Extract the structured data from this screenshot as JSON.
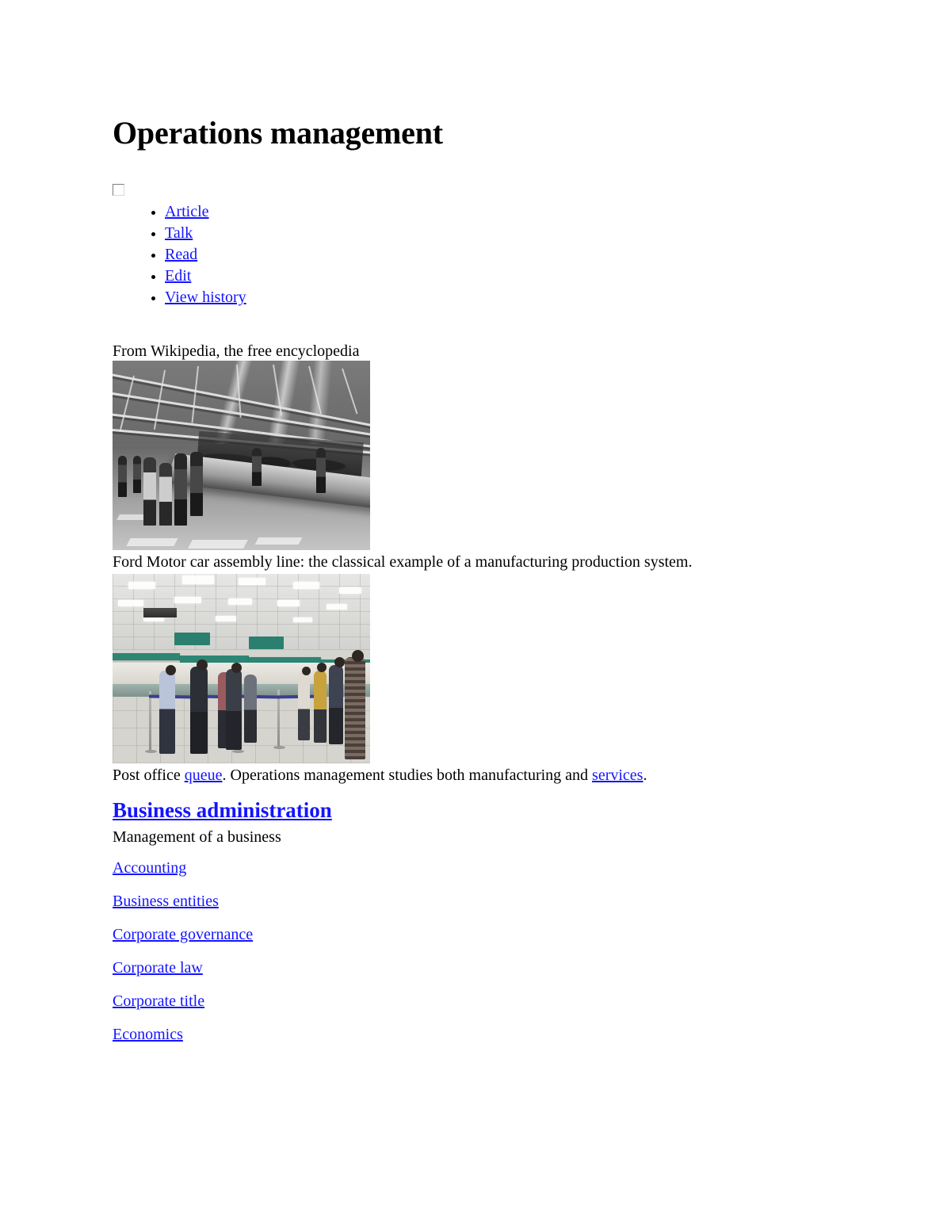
{
  "page": {
    "title": "Operations management",
    "source_line": "From Wikipedia, the free encyclopedia"
  },
  "namespace_tabs": [
    {
      "label": "Article"
    },
    {
      "label": "Talk"
    }
  ],
  "view_tabs": [
    {
      "label": "Read"
    },
    {
      "label": "Edit"
    },
    {
      "label": "View history"
    }
  ],
  "figures": [
    {
      "alt": "Ford Motor car assembly line",
      "caption": "Ford Motor car assembly line: the classical example of a manufacturing production system."
    },
    {
      "alt": "Post office queue",
      "caption_part_1": "Post office ",
      "caption_link_1": "queue",
      "caption_part_2": ". Operations management studies both manufacturing and ",
      "caption_link_2": "services",
      "caption_part_3": "."
    }
  ],
  "infobox": {
    "heading": "Business administration",
    "subtitle": "Management of a business",
    "links": [
      {
        "label": "Accounting"
      },
      {
        "label": "Business entities"
      },
      {
        "label": "Corporate governance"
      },
      {
        "label": "Corporate law"
      },
      {
        "label": "Corporate title"
      },
      {
        "label": "Economics"
      }
    ]
  },
  "colors": {
    "link": "#1414ff",
    "text": "#000000",
    "background": "#ffffff",
    "counter_teal": "#2d8574",
    "queue_rope": "#3b3f8f"
  }
}
